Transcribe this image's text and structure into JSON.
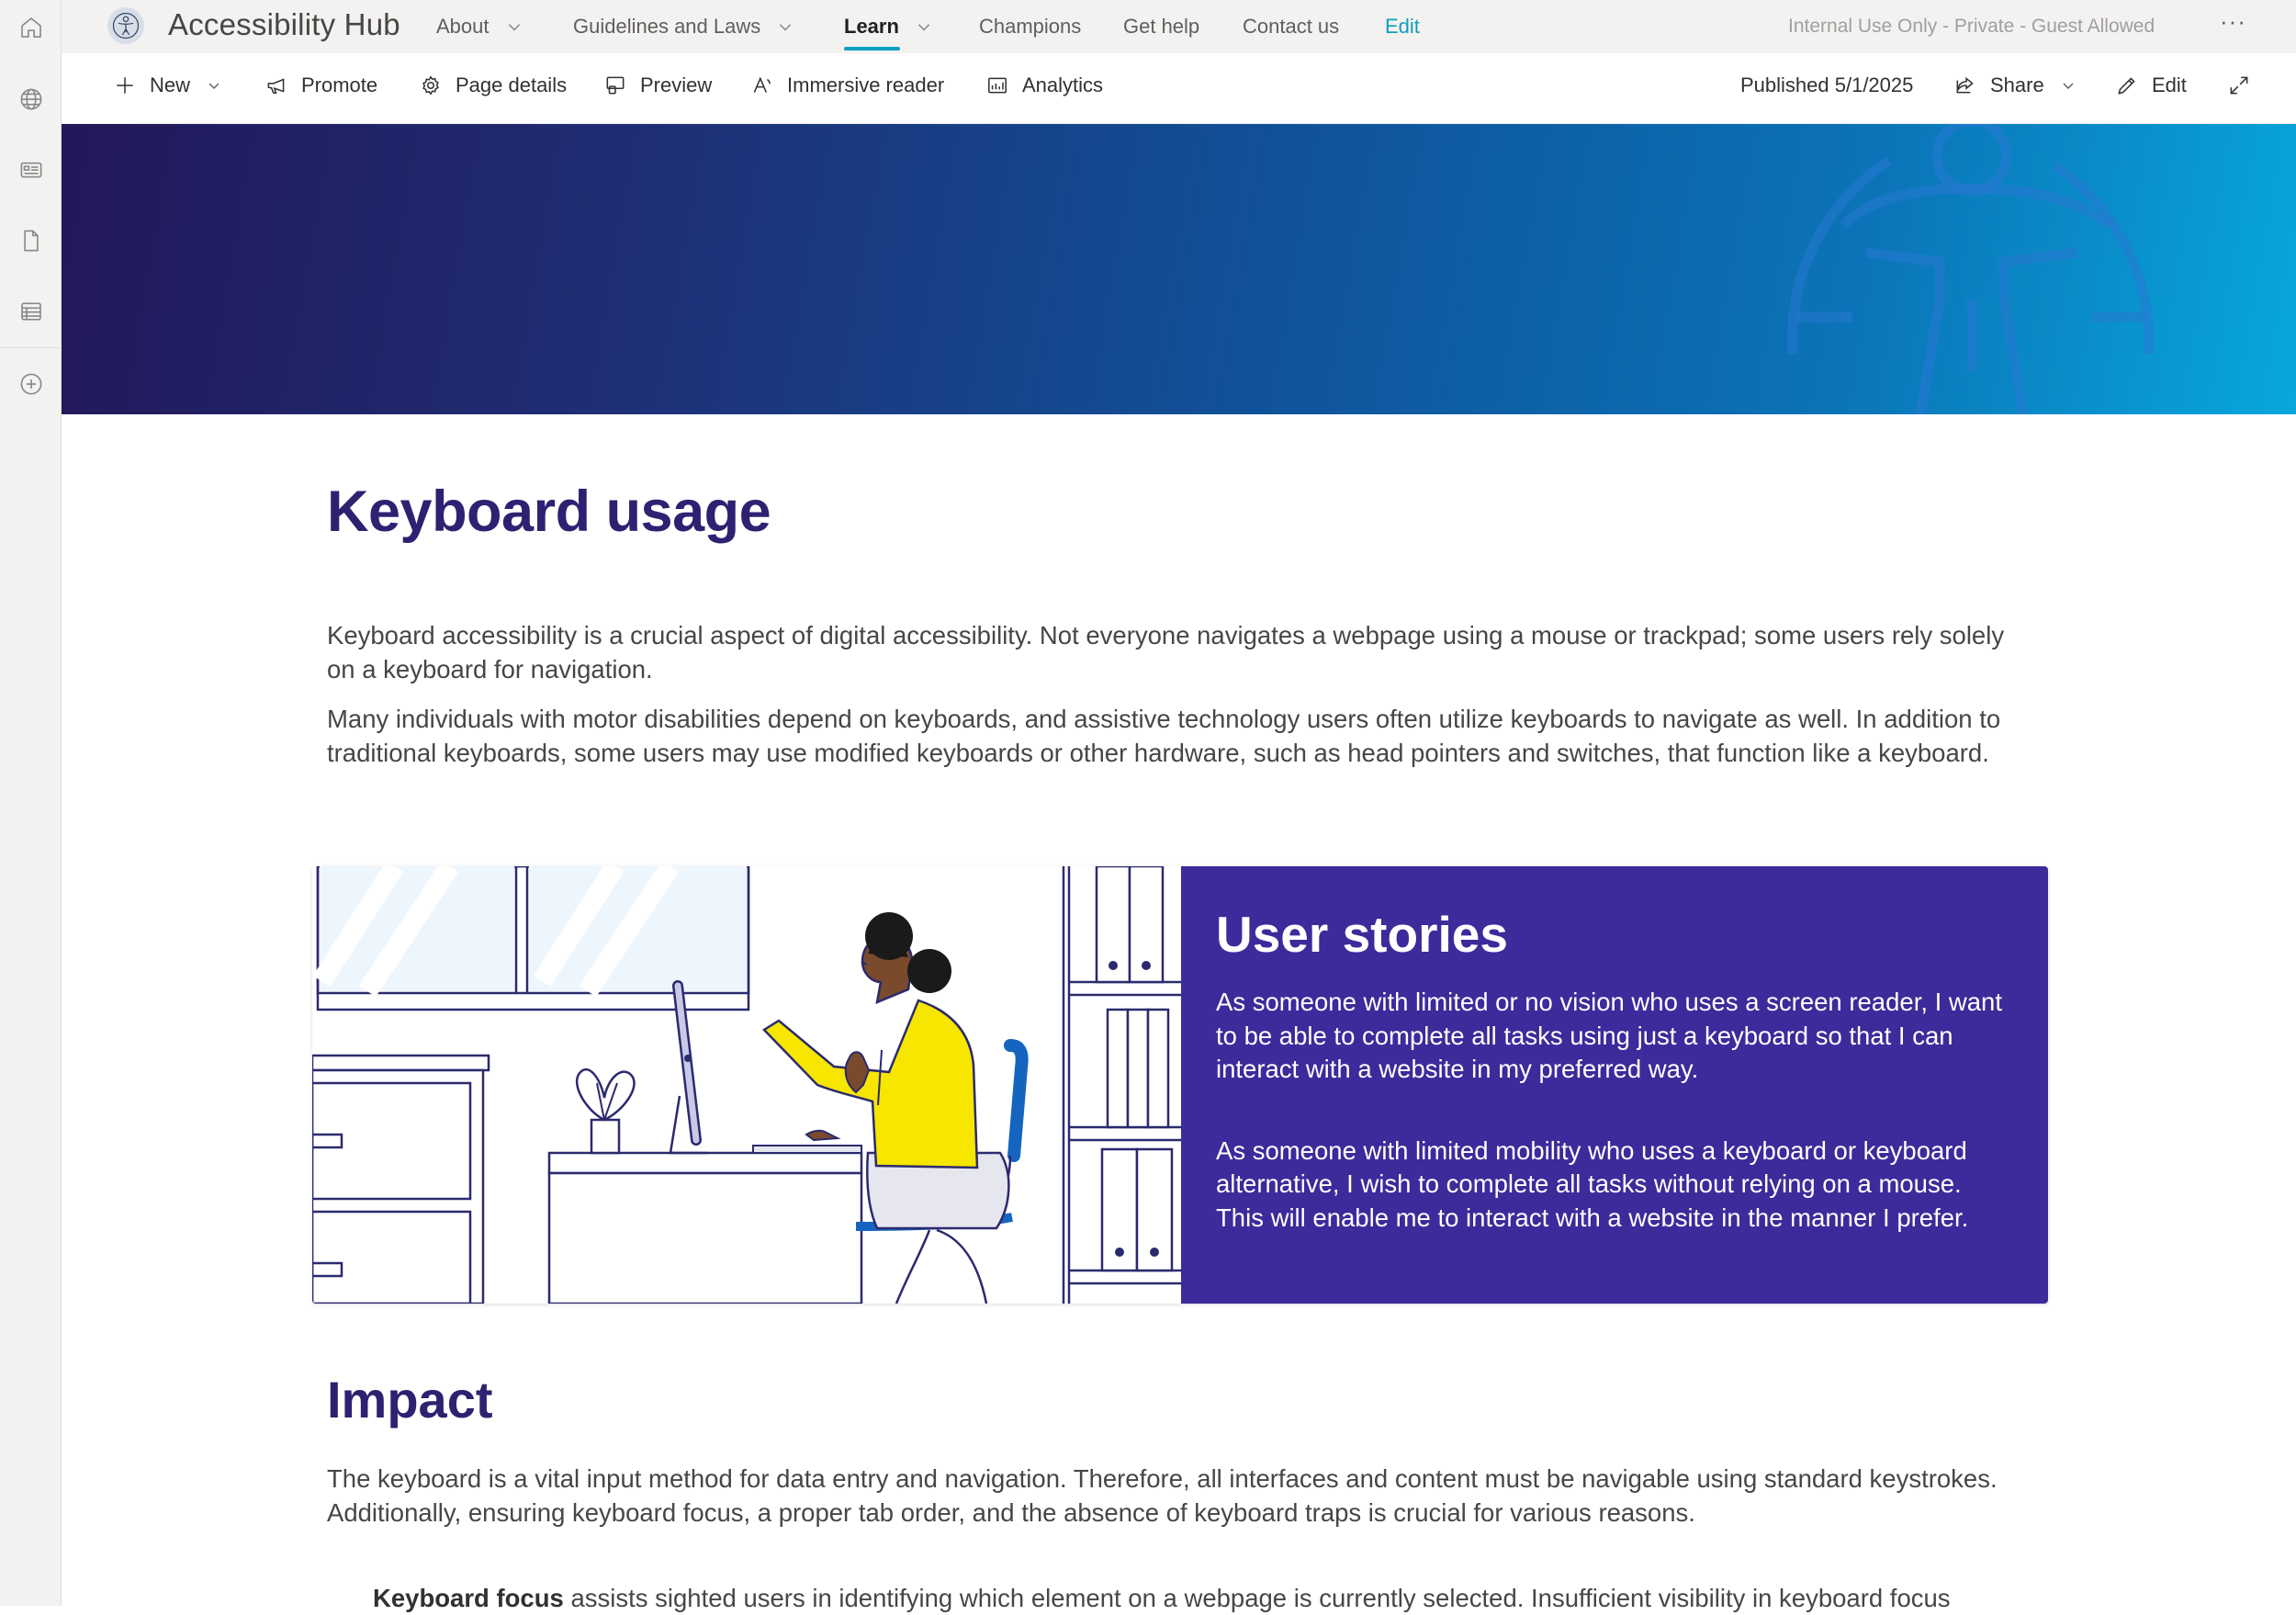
{
  "site": {
    "title": "Accessibility Hub",
    "classification": "Internal Use Only - Private - Guest Allowed"
  },
  "rail": {
    "items": [
      "home-icon",
      "globe-icon",
      "news-icon",
      "document-icon",
      "list-icon",
      "add-circle-icon"
    ]
  },
  "hubnav": {
    "items": [
      {
        "label": "About",
        "has_menu": true
      },
      {
        "label": "Guidelines and Laws",
        "has_menu": true
      },
      {
        "label": "Learn",
        "has_menu": true,
        "active": true
      },
      {
        "label": "Champions",
        "has_menu": false
      },
      {
        "label": "Get help",
        "has_menu": false
      },
      {
        "label": "Contact us",
        "has_menu": false
      }
    ],
    "edit_label": "Edit",
    "more_label": "···"
  },
  "commandbar": {
    "new_label": "New",
    "promote_label": "Promote",
    "page_details_label": "Page details",
    "preview_label": "Preview",
    "immersive_reader_label": "Immersive reader",
    "analytics_label": "Analytics",
    "published_label": "Published 5/1/2025",
    "share_label": "Share",
    "edit_label": "Edit"
  },
  "page": {
    "title": "Keyboard usage",
    "intro_1": "Keyboard accessibility is a crucial aspect of digital accessibility. Not everyone navigates a webpage using a mouse or trackpad; some users rely solely on a keyboard for navigation.",
    "intro_2": "Many individuals with motor disabilities depend on keyboards, and assistive technology users often utilize keyboards to navigate as well. In addition to traditional keyboards, some users may use modified keyboards or other hardware, such as head pointers and switches, that function like a keyboard.",
    "stories": {
      "title": "User stories",
      "story_1": "As someone with limited or no vision who uses a screen reader, I want to be able to complete all tasks using just a keyboard so that I can interact with a website in my preferred way.",
      "story_2": "As someone with limited mobility who uses a keyboard or keyboard alternative, I wish to complete all tasks without relying on a mouse. This will enable me to interact with a website in the manner I prefer."
    },
    "impact": {
      "heading": "Impact",
      "text": "The keyboard is a vital input method for data entry and navigation. Therefore, all interfaces and content must be navigable using standard keystrokes. Additionally, ensuring keyboard focus, a proper tab order, and the absence of keyboard traps is crucial for various reasons.",
      "bullet_1_term": "Keyboard focus",
      "bullet_1_text": " assists sighted users in identifying which element on a webpage is currently selected. Insufficient visibility in keyboard focus"
    }
  },
  "colors": {
    "accent": "#0f9fbf",
    "heading": "#2e2171",
    "stories_panel": "#3d2a9b",
    "illustration_yellow": "#f6e600",
    "illustration_blue": "#1565c0"
  }
}
